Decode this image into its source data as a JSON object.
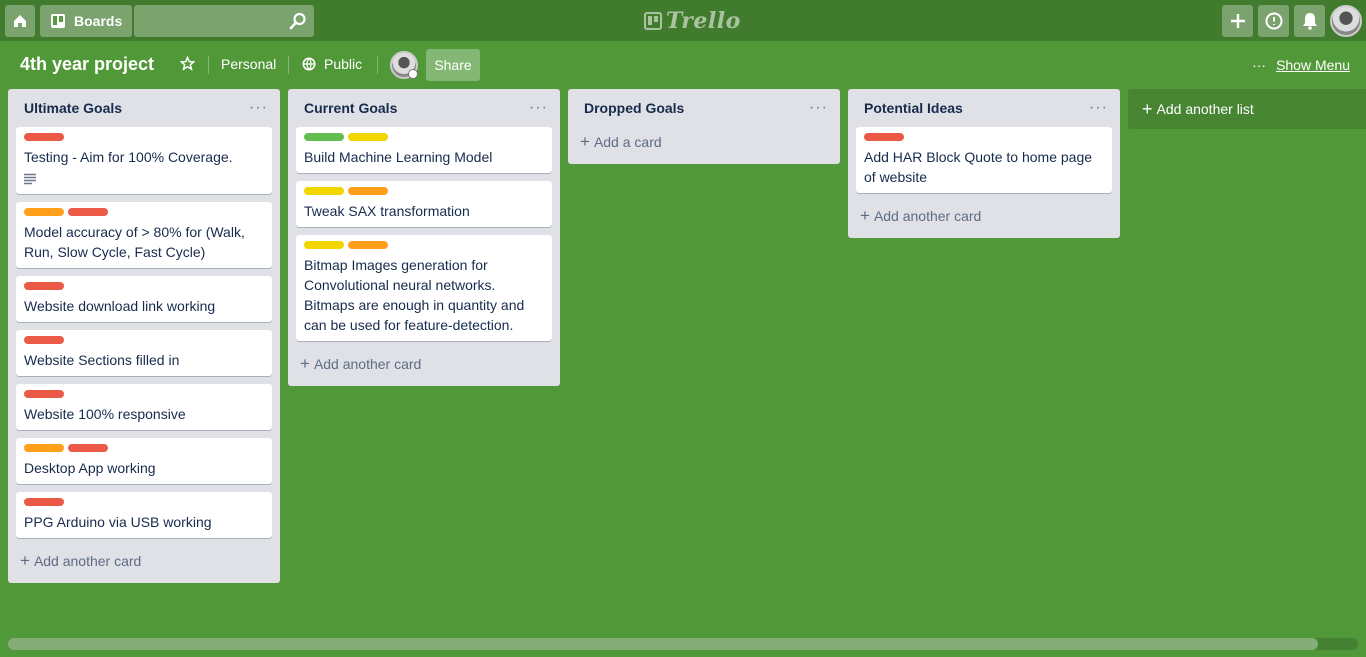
{
  "header": {
    "boards_label": "Boards",
    "search_placeholder": "",
    "logo_text": "Trello"
  },
  "board": {
    "title": "4th year project",
    "team": "Personal",
    "visibility": "Public",
    "share_label": "Share",
    "show_menu_label": "Show Menu"
  },
  "lists": [
    {
      "title": "Ultimate Goals",
      "add_label": "Add another card",
      "cards": [
        {
          "text": "Testing - Aim for 100% Coverage.",
          "labels": [
            "#eb5a46"
          ],
          "has_description": true
        },
        {
          "text": "Model accuracy of > 80% for (Walk, Run, Slow Cycle, Fast Cycle)",
          "labels": [
            "#ff9f1a",
            "#eb5a46"
          ]
        },
        {
          "text": "Website download link working",
          "labels": [
            "#eb5a46"
          ]
        },
        {
          "text": "Website Sections filled in",
          "labels": [
            "#eb5a46"
          ]
        },
        {
          "text": "Website 100% responsive",
          "labels": [
            "#eb5a46"
          ]
        },
        {
          "text": "Desktop App working",
          "labels": [
            "#ff9f1a",
            "#eb5a46"
          ]
        },
        {
          "text": "PPG Arduino via USB working",
          "labels": [
            "#eb5a46"
          ]
        }
      ]
    },
    {
      "title": "Current Goals",
      "add_label": "Add another card",
      "cards": [
        {
          "text": "Build Machine Learning Model",
          "labels": [
            "#61bd4f",
            "#f2d600"
          ]
        },
        {
          "text": "Tweak SAX transformation",
          "labels": [
            "#f2d600",
            "#ff9f1a"
          ]
        },
        {
          "text": "Bitmap Images generation for Convolutional neural networks. Bitmaps are enough in quantity and can be used for feature-detection.",
          "labels": [
            "#f2d600",
            "#ff9f1a"
          ]
        }
      ]
    },
    {
      "title": "Dropped Goals",
      "add_label": "Add a card",
      "cards": []
    },
    {
      "title": "Potential Ideas",
      "add_label": "Add another card",
      "cards": [
        {
          "text": "Add HAR Block Quote to home page of website",
          "labels": [
            "#eb5a46"
          ]
        }
      ]
    }
  ],
  "add_list_label": "Add another list",
  "colors": {
    "board_bg": "#519839",
    "header_bg": "#417b2e"
  }
}
